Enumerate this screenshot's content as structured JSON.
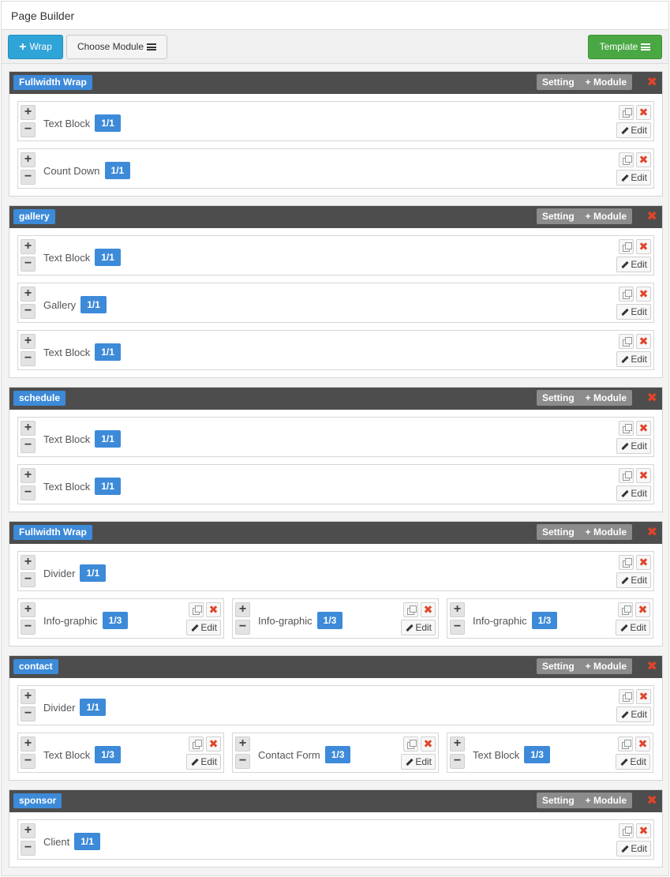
{
  "app": {
    "title": "Page Builder"
  },
  "toolbar": {
    "wrap_label": "Wrap",
    "choose_module_label": "Choose Module",
    "template_label": "Template"
  },
  "colors": {
    "wrap_tag": "#3d8ad8",
    "header": "#4d4d4d",
    "template": "#4aa844",
    "add_wrap": "#2fa4d6",
    "close": "#e0452a"
  },
  "wrap_controls": {
    "setting": "Setting",
    "add_module": "+ Module",
    "close": "✖"
  },
  "row_controls": {
    "edit": "Edit",
    "delete": "✖"
  },
  "wraps": [
    {
      "name": "Fullwidth Wrap",
      "rows": [
        [
          {
            "label": "Text Block",
            "size": "1/1"
          }
        ],
        [
          {
            "label": "Count Down",
            "size": "1/1"
          }
        ]
      ]
    },
    {
      "name": "gallery",
      "rows": [
        [
          {
            "label": "Text Block",
            "size": "1/1"
          }
        ],
        [
          {
            "label": "Gallery",
            "size": "1/1"
          }
        ],
        [
          {
            "label": "Text Block",
            "size": "1/1"
          }
        ]
      ]
    },
    {
      "name": "schedule",
      "rows": [
        [
          {
            "label": "Text Block",
            "size": "1/1"
          }
        ],
        [
          {
            "label": "Text Block",
            "size": "1/1"
          }
        ]
      ]
    },
    {
      "name": "Fullwidth Wrap",
      "rows": [
        [
          {
            "label": "Divider",
            "size": "1/1"
          }
        ],
        [
          {
            "label": "Info-graphic",
            "size": "1/3"
          },
          {
            "label": "Info-graphic",
            "size": "1/3"
          },
          {
            "label": "Info-graphic",
            "size": "1/3"
          }
        ]
      ]
    },
    {
      "name": "contact",
      "rows": [
        [
          {
            "label": "Divider",
            "size": "1/1"
          }
        ],
        [
          {
            "label": "Text Block",
            "size": "1/3"
          },
          {
            "label": "Contact Form",
            "size": "1/3"
          },
          {
            "label": "Text Block",
            "size": "1/3"
          }
        ]
      ]
    },
    {
      "name": "sponsor",
      "rows": [
        [
          {
            "label": "Client",
            "size": "1/1"
          }
        ]
      ]
    }
  ]
}
